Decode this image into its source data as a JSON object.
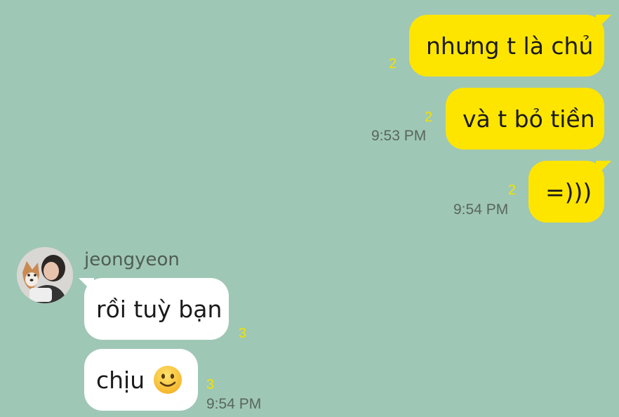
{
  "conversation": {
    "messages_out": [
      {
        "text": "nhưng t là chủ",
        "unread": "2"
      },
      {
        "text": "và t bỏ tiền",
        "unread": "2",
        "time": "9:53 PM"
      },
      {
        "text": "=)))",
        "unread": "2",
        "time": "9:54 PM"
      }
    ],
    "contact": {
      "name": "jeongyeon",
      "avatar_icon": "profile-photo-with-dog"
    },
    "messages_in": [
      {
        "text": "rồi tuỳ bạn",
        "unread": "3"
      },
      {
        "text": "chịu",
        "emoji": "slightly-smiling-face-icon",
        "unread": "3",
        "time": "9:54 PM"
      }
    ]
  },
  "colors": {
    "background": "#9fc7b5",
    "outgoing_bubble": "#fee500",
    "incoming_bubble": "#ffffff",
    "unread_count": "#f2e300",
    "timestamp": "#58665f"
  }
}
